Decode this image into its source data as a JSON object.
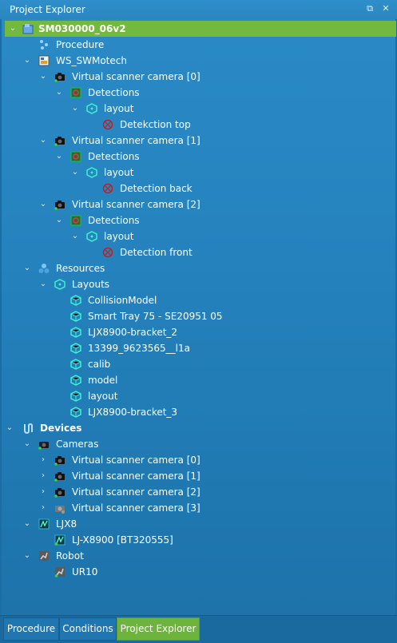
{
  "window": {
    "title": "Project Explorer",
    "pin_icon": "pin-icon",
    "close_icon": "close-icon"
  },
  "tree": {
    "project": "SM030000_06v2",
    "procedure": "Procedure",
    "workspace": "WS_SWMotech",
    "cameras": [
      {
        "label": "Virtual scanner camera [0]",
        "detections": "Detections",
        "layout": "layout",
        "detection": "Detekction top"
      },
      {
        "label": "Virtual scanner camera [1]",
        "detections": "Detections",
        "layout": "layout",
        "detection": "Detection back"
      },
      {
        "label": "Virtual scanner camera [2]",
        "detections": "Detections",
        "layout": "layout",
        "detection": "Detection front"
      }
    ],
    "resources": {
      "label": "Resources",
      "layouts_label": "Layouts",
      "items": [
        "CollisionModel",
        "Smart Tray 75 - SE20951 05",
        "LJX8900-bracket_2",
        "13399_9623565__l1a",
        "calib",
        "model",
        "layout",
        "LJX8900-bracket_3"
      ]
    },
    "devices": {
      "label": "Devices",
      "cameras_label": "Cameras",
      "cameras": [
        "Virtual scanner camera [0]",
        "Virtual scanner camera [1]",
        "Virtual scanner camera [2]",
        "Virtual scanner camera [3]"
      ],
      "ljx_label": "LJX8",
      "ljx_device": "LJ-X8900 [BT320555]",
      "robot_label": "Robot",
      "robot_device": "UR10"
    }
  },
  "tabs": [
    "Procedure",
    "Conditions",
    "Project Explorer"
  ],
  "active_tab": "Project Explorer",
  "colors": {
    "selection": "#72b93d",
    "background": "#2582bd",
    "active_tab": "#6db43c"
  }
}
